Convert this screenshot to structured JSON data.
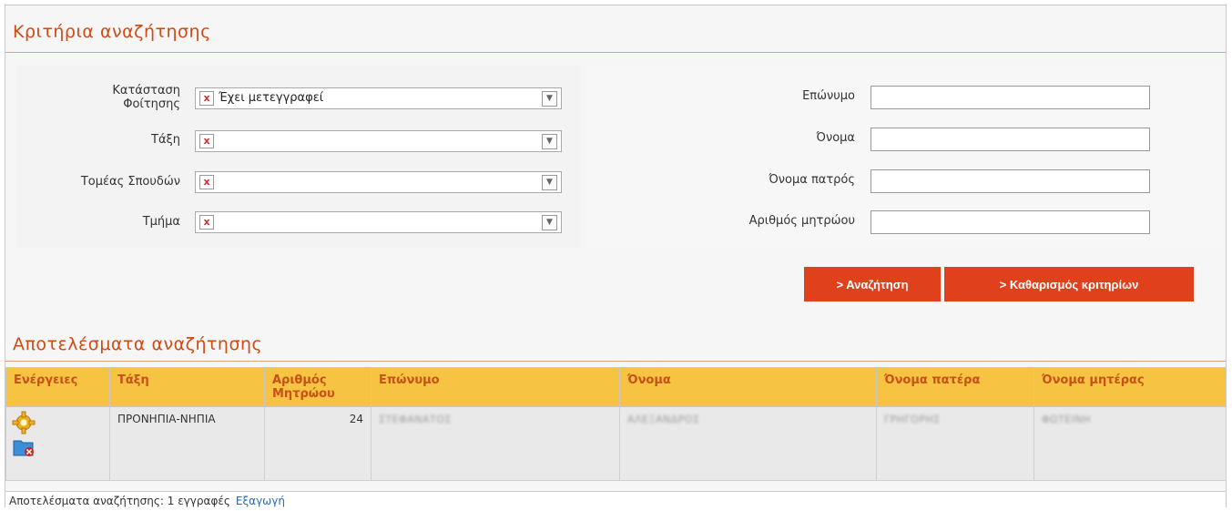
{
  "criteria": {
    "title": "Κριτήρια αναζήτησης",
    "status_label_line1": "Κατάσταση",
    "status_label_line2": "Φοίτησης",
    "status_value": "Έχει μετεγγραφεί",
    "class_label": "Τάξη",
    "class_value": "",
    "sector_label": "Τομέας Σπουδών",
    "sector_value": "",
    "department_label": "Τμήμα",
    "department_value": "",
    "clear_mark": "x",
    "surname_label": "Επώνυμο",
    "surname_value": "",
    "name_label": "Όνομα",
    "name_value": "",
    "father_label": "Όνομα πατρός",
    "father_value": "",
    "registry_label": "Αριθμός μητρώου",
    "registry_value": "",
    "search_button": "> Αναζήτηση",
    "clear_button": "> Καθαρισμός κριτηρίων"
  },
  "results": {
    "title": "Αποτελέσματα αναζήτησης",
    "columns": {
      "actions": "Ενέργειες",
      "class": "Τάξη",
      "registry_line1": "Αριθμός",
      "registry_line2": "Μητρώου",
      "surname": "Επώνυμο",
      "name": "Όνομα",
      "father": "Όνομα πατέρα",
      "mother": "Όνομα μητέρας"
    },
    "rows": [
      {
        "class": "ΠΡΟΝΗΠΙΑ-ΝΗΠΙΑ",
        "registry": "24",
        "surname": "ΣΤΕΦΑΝΑΤΟΣ",
        "name": "ΑΛΕΞΑΝΔΡΟΣ",
        "father": "ΓΡΗΓΟΡΗΣ",
        "mother": "ΦΩΤΕΙΝΗ"
      }
    ],
    "footer_text": "Αποτελέσματα αναζήτησης: 1 εγγραφές",
    "export_link": "Εξαγωγή"
  },
  "colors": {
    "accent": "#d04a12",
    "button": "#e0401c",
    "table_header": "#f7c342"
  }
}
